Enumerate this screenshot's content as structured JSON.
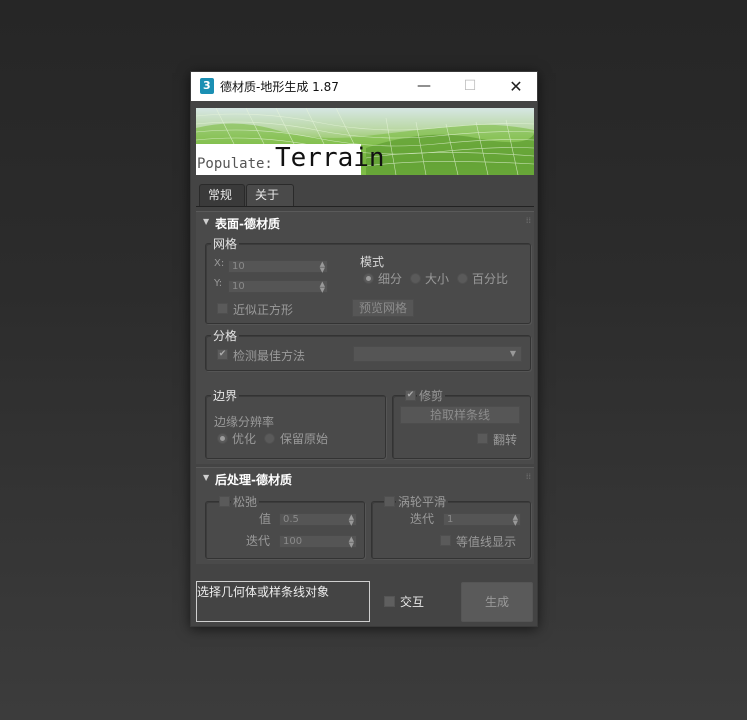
{
  "window": {
    "title": "德材质-地形生成 1.87",
    "minimize": "—",
    "maximize": "☐",
    "close": "✕"
  },
  "banner": {
    "prefix": "Populate:",
    "main": "Terrain"
  },
  "tabs": [
    {
      "label": "常规",
      "selected": true
    },
    {
      "label": "关于",
      "selected": false
    }
  ],
  "surface": {
    "title": "表面-德材质",
    "mesh": {
      "title": "网格",
      "x_label": "X:",
      "x_value": "10",
      "y_label": "Y:",
      "y_value": "10",
      "square_label": "近似正方形",
      "mode_label": "模式",
      "mode_options": [
        "细分",
        "大小",
        "百分比"
      ],
      "mode_selected": "细分",
      "preview_button": "预览网格"
    },
    "split": {
      "title": "分格",
      "detect_label": "检测最佳方法",
      "detect_checked": true,
      "method_value": ""
    },
    "border": {
      "title": "边界",
      "resolution_label": "边缘分辨率",
      "options": [
        "优化",
        "保留原始"
      ],
      "selected": "优化"
    },
    "trim": {
      "title": "修剪",
      "checked": true,
      "pick_button": "拾取样条线",
      "flip_label": "翻转"
    }
  },
  "post": {
    "title": "后处理-德材质",
    "relax": {
      "title": "松弛",
      "value_label": "值",
      "value": "0.5",
      "iter_label": "迭代",
      "iter_value": "100"
    },
    "turbo": {
      "title": "涡轮平滑",
      "iter_label": "迭代",
      "iter_value": "1",
      "isoline_label": "等值线显示"
    }
  },
  "footer": {
    "status": "选择几何体或样条线对象",
    "interactive_label": "交互",
    "generate_button": "生成"
  }
}
